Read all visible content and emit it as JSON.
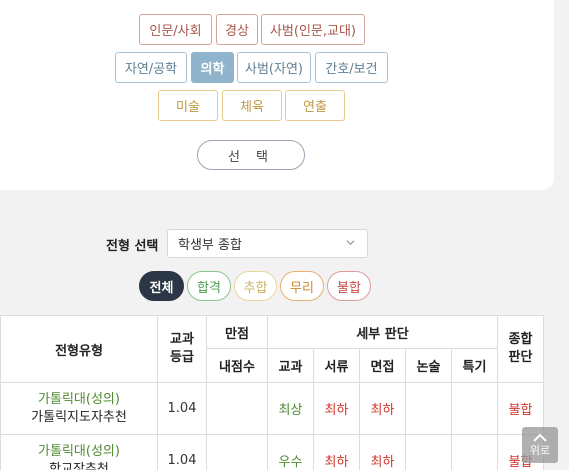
{
  "majors": {
    "row1": [
      "인문/사회",
      "경상",
      "사범(인문,교대)"
    ],
    "row2": [
      "자연/공학",
      "의학",
      "사범(자연)",
      "간호/보건"
    ],
    "row3": [
      "미술",
      "체육",
      "연출"
    ],
    "active": "의학",
    "select_label": "선 택"
  },
  "type_select": {
    "label": "전형 선택",
    "value": "학생부 종합"
  },
  "filters": [
    "전체",
    "합격",
    "추합",
    "무리",
    "불합"
  ],
  "table": {
    "headers": {
      "type": "전형유형",
      "grade": "교과\n등급",
      "score": "만점",
      "score_sub": "내점수",
      "detail": "세부 판단",
      "detail_cols": [
        "교과",
        "서류",
        "면접",
        "논술",
        "특기"
      ],
      "total": "종합\n판단"
    },
    "rows": [
      {
        "uni": "가톨릭대(성의)",
        "track": "가톨릭지도자추천",
        "grade": "1.04",
        "my_score": "",
        "subj": "최상",
        "docs": "최하",
        "interview": "최하",
        "essay": "",
        "special": "",
        "verdict": "불합"
      },
      {
        "uni": "가톨릭대(성의)",
        "track": "학교장추천",
        "grade": "1.04",
        "my_score": "",
        "subj": "우수",
        "docs": "최하",
        "interview": "최하",
        "essay": "",
        "special": "",
        "verdict": "불합"
      }
    ]
  },
  "scroll_top_label": "위로",
  "colors": {
    "active_major": "#8fb4cb",
    "filter_all": "#2b3746",
    "green_text": "#4f8a2f",
    "red_text": "#d2352b"
  }
}
